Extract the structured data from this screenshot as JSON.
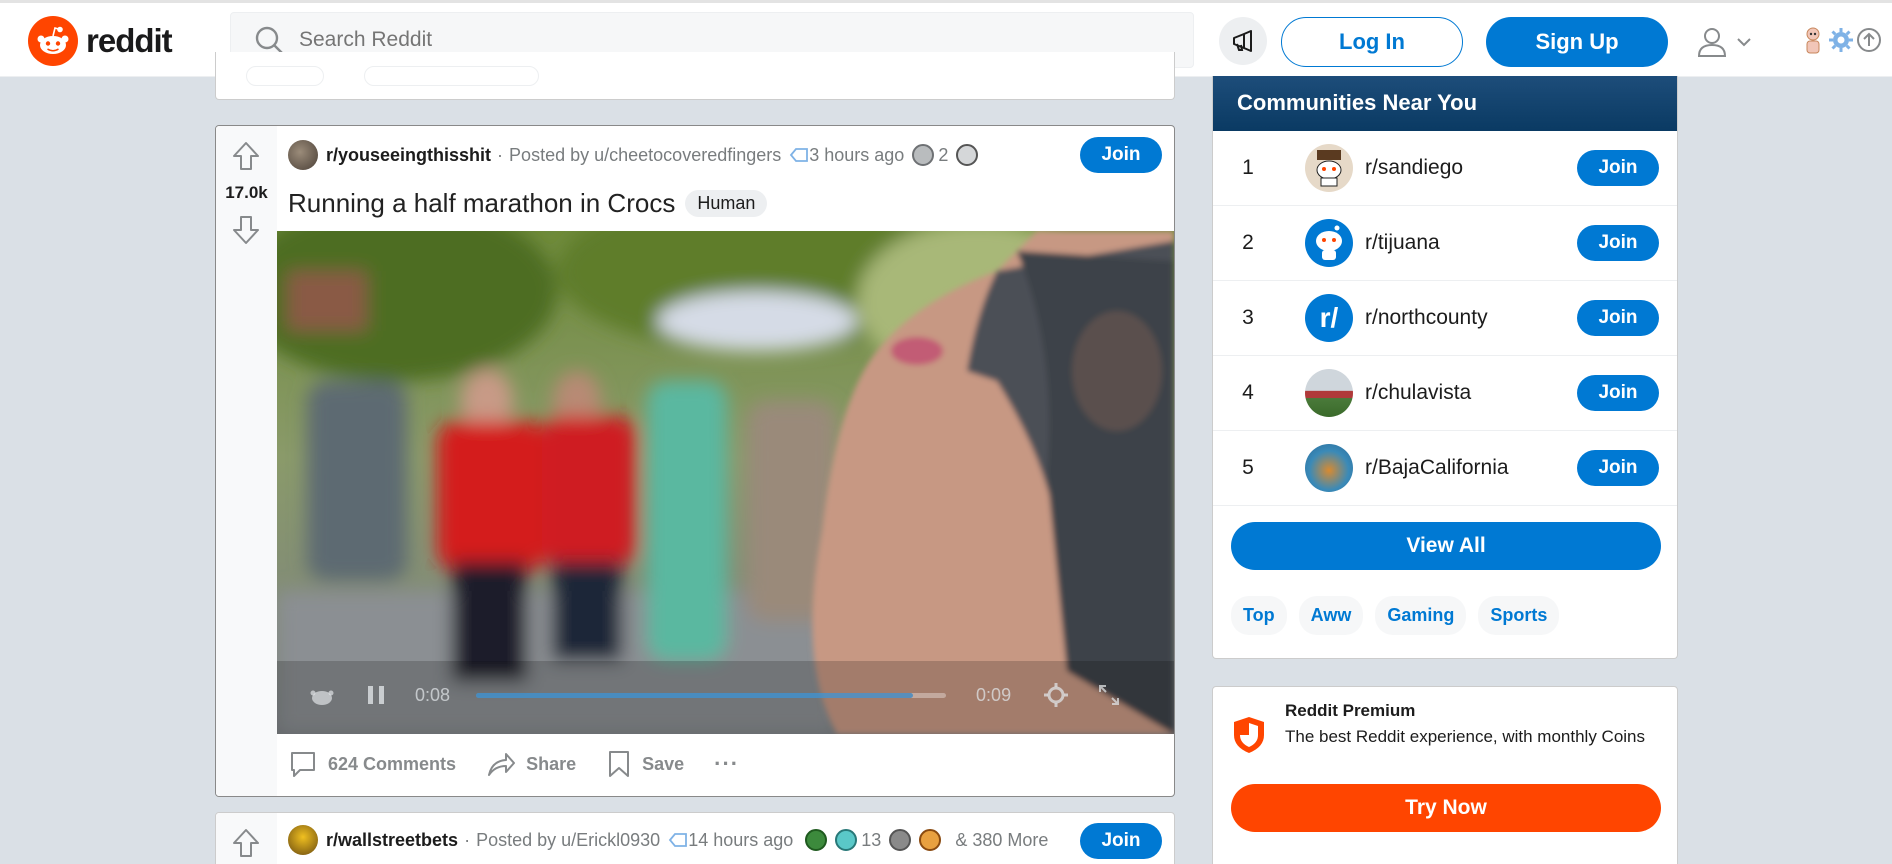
{
  "header": {
    "logo_text": "reddit",
    "search_placeholder": "Search Reddit",
    "login_label": "Log In",
    "signup_label": "Sign Up"
  },
  "post": {
    "vote_count": "17.0k",
    "subreddit": "r/youseeingthisshit",
    "posted_by_prefix": "Posted by",
    "author": "u/cheetocoveredfingers",
    "time": "3 hours ago",
    "award_count": "2",
    "join_label": "Join",
    "title": "Running a half marathon in Crocs",
    "flair": "Human",
    "video": {
      "current_time": "0:08",
      "duration": "0:09",
      "progress": 0.93
    },
    "comments_label": "624 Comments",
    "share_label": "Share",
    "save_label": "Save",
    "more_label": "···"
  },
  "post2": {
    "subreddit": "r/wallstreetbets",
    "posted_by_prefix": "Posted by",
    "author": "u/Erickl0930",
    "time": "14 hours ago",
    "award_count": "13",
    "more_awards": "& 380 More",
    "join_label": "Join"
  },
  "sidebar": {
    "title": "Communities Near You",
    "communities": [
      {
        "rank": "1",
        "name": "r/sandiego",
        "join": "Join"
      },
      {
        "rank": "2",
        "name": "r/tijuana",
        "join": "Join"
      },
      {
        "rank": "3",
        "name": "r/northcounty",
        "join": "Join"
      },
      {
        "rank": "4",
        "name": "r/chulavista",
        "join": "Join"
      },
      {
        "rank": "5",
        "name": "r/BajaCalifornia",
        "join": "Join"
      }
    ],
    "view_all_label": "View All",
    "topics": [
      "Top",
      "Aww",
      "Gaming",
      "Sports"
    ]
  },
  "premium": {
    "title": "Reddit Premium",
    "description": "The best Reddit experience, with monthly Coins",
    "button_label": "Try Now"
  },
  "colors": {
    "brand": "#ff4500",
    "accent": "#0079d3"
  }
}
